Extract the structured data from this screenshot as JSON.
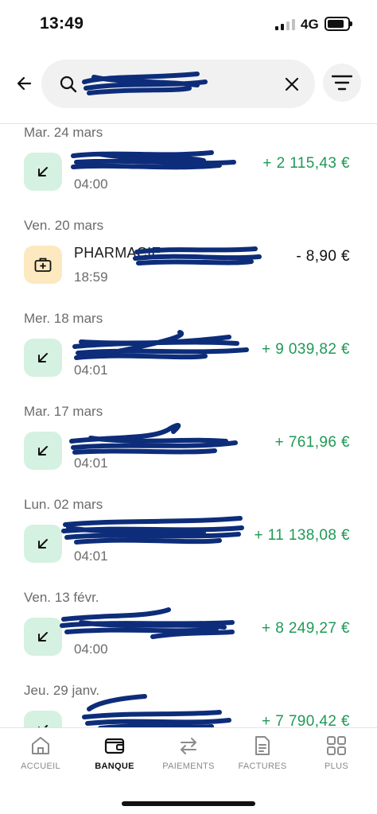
{
  "status_bar": {
    "time": "13:49",
    "network": "4G"
  },
  "search": {
    "placeholder": "",
    "value": ""
  },
  "icons": {
    "back": "arrow-left-icon",
    "search": "search-icon",
    "clear": "close-icon",
    "filter": "filter-icon",
    "credit": "arrow-down-left-icon",
    "health": "medical-bag-icon"
  },
  "colors": {
    "positive": "#1e9a55",
    "credit_bg": "#d5f1e1",
    "health_bg": "#fde9bf",
    "redaction": "#0d2d7a"
  },
  "transactions": [
    {
      "date": "Mar. 24 mars",
      "name": "",
      "time": "04:00",
      "amount": "+ 2 115,43 €",
      "type": "credit"
    },
    {
      "date": "Ven. 20 mars",
      "name": "PHARMACIE",
      "time": "18:59",
      "amount": "-  8,90 €",
      "type": "health"
    },
    {
      "date": "Mer. 18 mars",
      "name": "",
      "time": "04:01",
      "amount": "+ 9 039,82 €",
      "type": "credit"
    },
    {
      "date": "Mar. 17 mars",
      "name": "",
      "time": "04:01",
      "amount": "+ 761,96 €",
      "type": "credit"
    },
    {
      "date": "Lun. 02 mars",
      "name": "",
      "time": "04:01",
      "amount": "+ 11 138,08 €",
      "type": "credit"
    },
    {
      "date": "Ven. 13 févr.",
      "name": "",
      "time": "04:00",
      "amount": "+ 8 249,27 €",
      "type": "credit"
    },
    {
      "date": "Jeu. 29 janv.",
      "name": "",
      "time": "",
      "amount": "+ 7 790,42 €",
      "type": "credit"
    }
  ],
  "nav": {
    "items": [
      {
        "label": "ACCUEIL",
        "icon": "home-icon"
      },
      {
        "label": "BANQUE",
        "icon": "wallet-icon",
        "active": true
      },
      {
        "label": "PAIEMENTS",
        "icon": "transfer-icon"
      },
      {
        "label": "FACTURES",
        "icon": "document-icon"
      },
      {
        "label": "PLUS",
        "icon": "grid-icon"
      }
    ]
  }
}
